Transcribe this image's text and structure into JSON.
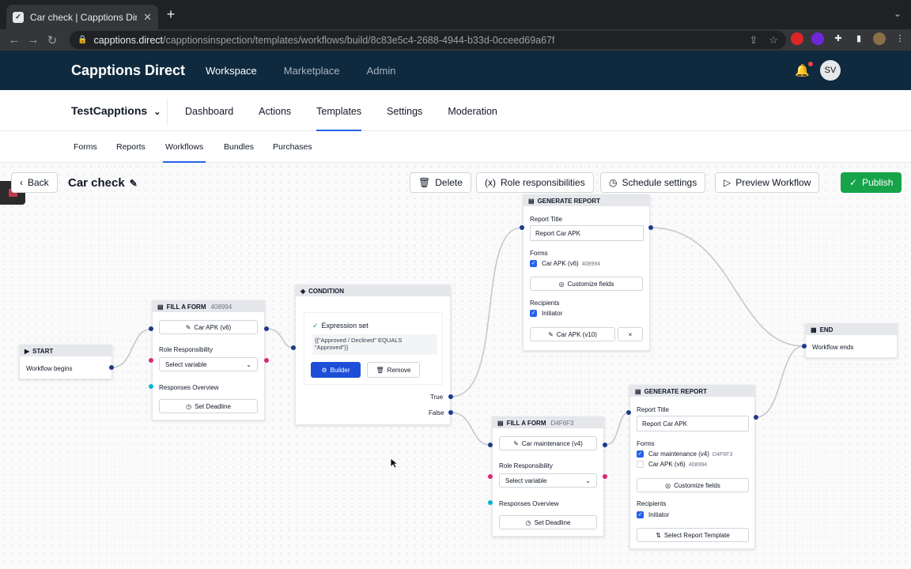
{
  "browser": {
    "tab_title": "Car check | Capptions Direct",
    "url_host": "capptions.direct",
    "url_path": "/capptionsinspection/templates/workflows/build/8c83e5c4-2688-4944-b33d-0cceed69a67f"
  },
  "app": {
    "brand": "Capptions Direct",
    "topnav": [
      "Workspace",
      "Marketplace",
      "Admin"
    ],
    "avatar": "SV"
  },
  "org": {
    "name": "TestCapptions",
    "mainnav": [
      "Dashboard",
      "Actions",
      "Templates",
      "Settings",
      "Moderation"
    ],
    "tabs": [
      "Forms",
      "Reports",
      "Workflows",
      "Bundles",
      "Purchases"
    ]
  },
  "toolbar": {
    "back": "Back",
    "title": "Car check",
    "delete": "Delete",
    "roles": "Role responsibilities",
    "schedule": "Schedule settings",
    "preview": "Preview Workflow",
    "publish": "Publish"
  },
  "nodes": {
    "start": {
      "header": "START",
      "text": "Workflow begins"
    },
    "form1": {
      "header": "FILL A FORM",
      "code": "408994",
      "form": "Car APK (v6)",
      "role_label": "Role Responsibility",
      "role_value": "Select variable",
      "responses": "Responses Overview",
      "deadline": "Set Deadline"
    },
    "cond": {
      "header": "CONDITION",
      "status": "Expression set",
      "expr": "{{\"Approved / Declined\" EQUALS \"Approved\"}}",
      "builder": "Builder",
      "remove": "Remove",
      "true": "True",
      "false": "False"
    },
    "report1": {
      "header": "GENERATE REPORT",
      "title_label": "Report Title",
      "title_value": "Report Car APK",
      "forms_label": "Forms",
      "form": "Car APK (v6)",
      "form_code": "408994",
      "customize": "Customize fields",
      "recipients_label": "Recipients",
      "recipient": "Initiator",
      "template": "Car APK (v10)",
      "close": "×"
    },
    "end": {
      "header": "END",
      "text": "Workflow ends"
    },
    "form2": {
      "header": "FILL A FORM",
      "code": "D4F6F3",
      "form": "Car maintenance (v4)",
      "role_label": "Role Responsibility",
      "role_value": "Select variable",
      "responses": "Responses Overview",
      "deadline": "Set Deadline"
    },
    "report2": {
      "header": "GENERATE REPORT",
      "title_label": "Report Title",
      "title_value": "Report Car APK",
      "forms_label": "Forms",
      "form_a": "Car maintenance (v4)",
      "form_a_code": "D4F6F3",
      "form_b": "Car APK (v6)",
      "form_b_code": "408994",
      "customize": "Customize fields",
      "recipients_label": "Recipients",
      "recipient": "Initiator",
      "select_template": "Select Report Template"
    }
  }
}
